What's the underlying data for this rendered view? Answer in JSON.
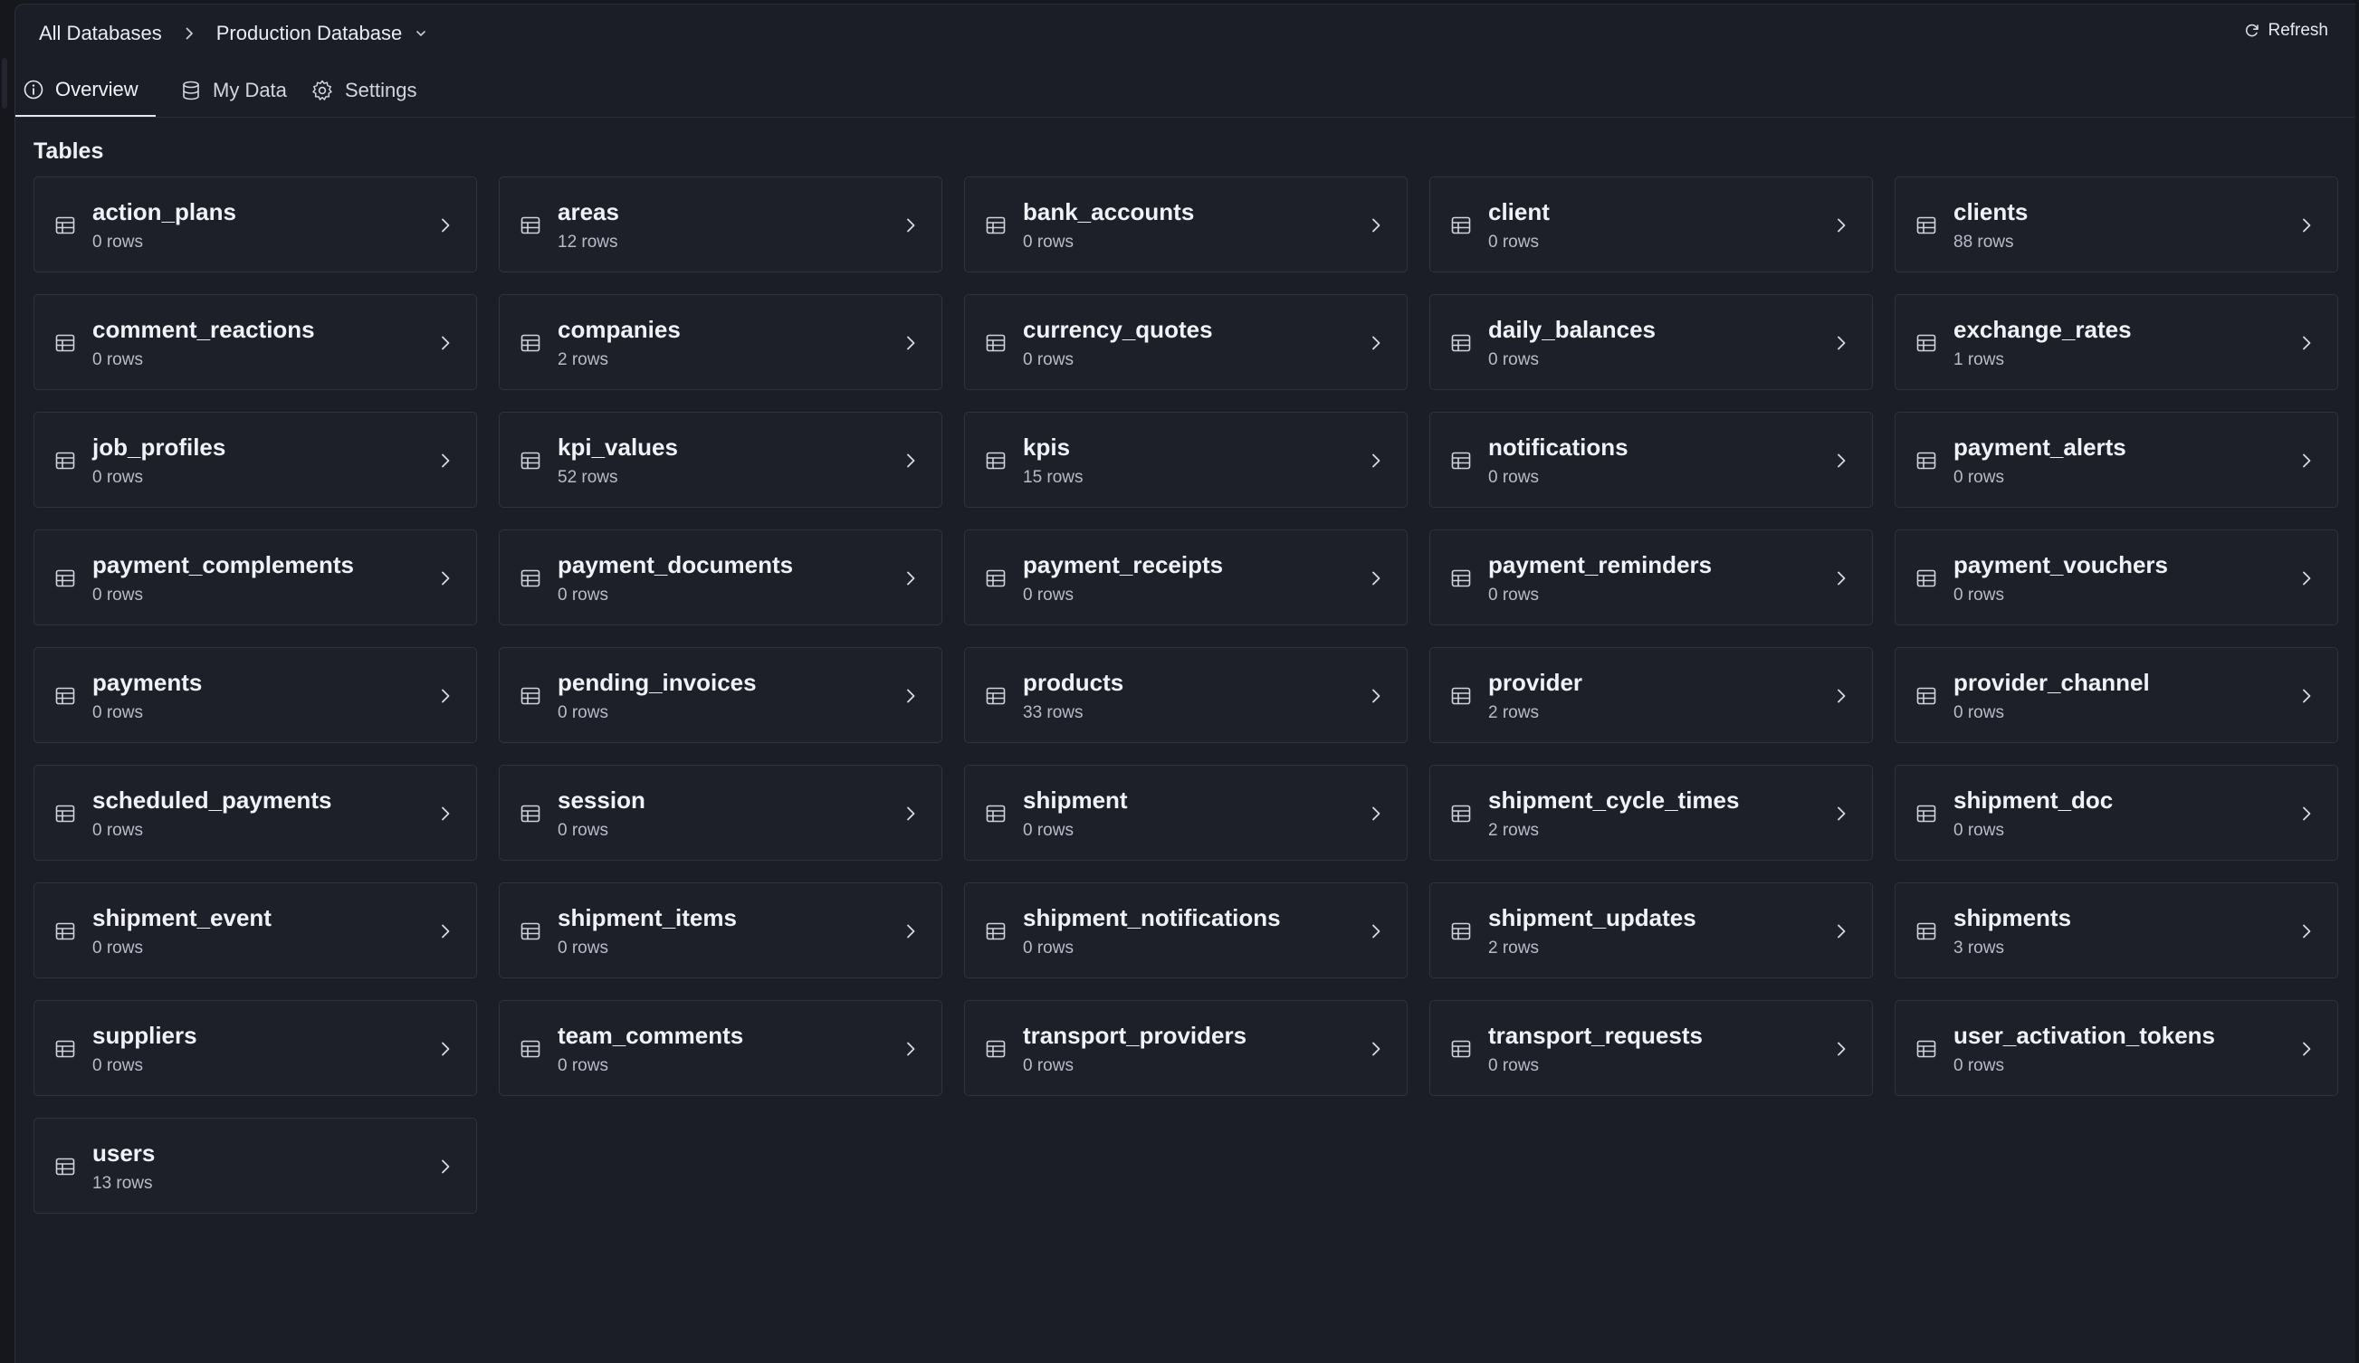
{
  "breadcrumb": {
    "root": "All Databases",
    "current": "Production Database",
    "separator_icon": "chevron-right-icon",
    "dropdown_icon": "chevron-down-icon"
  },
  "refresh": {
    "label": "Refresh",
    "icon": "refresh-icon"
  },
  "tabs": [
    {
      "label": "Overview",
      "icon": "info-icon",
      "active": true
    },
    {
      "label": "My Data",
      "icon": "database-icon",
      "active": false
    },
    {
      "label": "Settings",
      "icon": "gear-icon",
      "active": false
    }
  ],
  "section_title": "Tables",
  "tables": [
    {
      "name": "action_plans",
      "rows": "0 rows"
    },
    {
      "name": "areas",
      "rows": "12 rows"
    },
    {
      "name": "bank_accounts",
      "rows": "0 rows"
    },
    {
      "name": "client",
      "rows": "0 rows"
    },
    {
      "name": "clients",
      "rows": "88 rows"
    },
    {
      "name": "comment_reactions",
      "rows": "0 rows"
    },
    {
      "name": "companies",
      "rows": "2 rows"
    },
    {
      "name": "currency_quotes",
      "rows": "0 rows"
    },
    {
      "name": "daily_balances",
      "rows": "0 rows"
    },
    {
      "name": "exchange_rates",
      "rows": "1 rows"
    },
    {
      "name": "job_profiles",
      "rows": "0 rows"
    },
    {
      "name": "kpi_values",
      "rows": "52 rows"
    },
    {
      "name": "kpis",
      "rows": "15 rows"
    },
    {
      "name": "notifications",
      "rows": "0 rows"
    },
    {
      "name": "payment_alerts",
      "rows": "0 rows"
    },
    {
      "name": "payment_complements",
      "rows": "0 rows"
    },
    {
      "name": "payment_documents",
      "rows": "0 rows"
    },
    {
      "name": "payment_receipts",
      "rows": "0 rows"
    },
    {
      "name": "payment_reminders",
      "rows": "0 rows"
    },
    {
      "name": "payment_vouchers",
      "rows": "0 rows"
    },
    {
      "name": "payments",
      "rows": "0 rows"
    },
    {
      "name": "pending_invoices",
      "rows": "0 rows"
    },
    {
      "name": "products",
      "rows": "33 rows"
    },
    {
      "name": "provider",
      "rows": "2 rows"
    },
    {
      "name": "provider_channel",
      "rows": "0 rows"
    },
    {
      "name": "scheduled_payments",
      "rows": "0 rows"
    },
    {
      "name": "session",
      "rows": "0 rows"
    },
    {
      "name": "shipment",
      "rows": "0 rows"
    },
    {
      "name": "shipment_cycle_times",
      "rows": "2 rows"
    },
    {
      "name": "shipment_doc",
      "rows": "0 rows"
    },
    {
      "name": "shipment_event",
      "rows": "0 rows"
    },
    {
      "name": "shipment_items",
      "rows": "0 rows"
    },
    {
      "name": "shipment_notifications",
      "rows": "0 rows"
    },
    {
      "name": "shipment_updates",
      "rows": "2 rows"
    },
    {
      "name": "shipments",
      "rows": "3 rows"
    },
    {
      "name": "suppliers",
      "rows": "0 rows"
    },
    {
      "name": "team_comments",
      "rows": "0 rows"
    },
    {
      "name": "transport_providers",
      "rows": "0 rows"
    },
    {
      "name": "transport_requests",
      "rows": "0 rows"
    },
    {
      "name": "user_activation_tokens",
      "rows": "0 rows"
    },
    {
      "name": "users",
      "rows": "13 rows"
    }
  ],
  "card_icon": "table-icon",
  "card_chevron_icon": "chevron-right-icon"
}
